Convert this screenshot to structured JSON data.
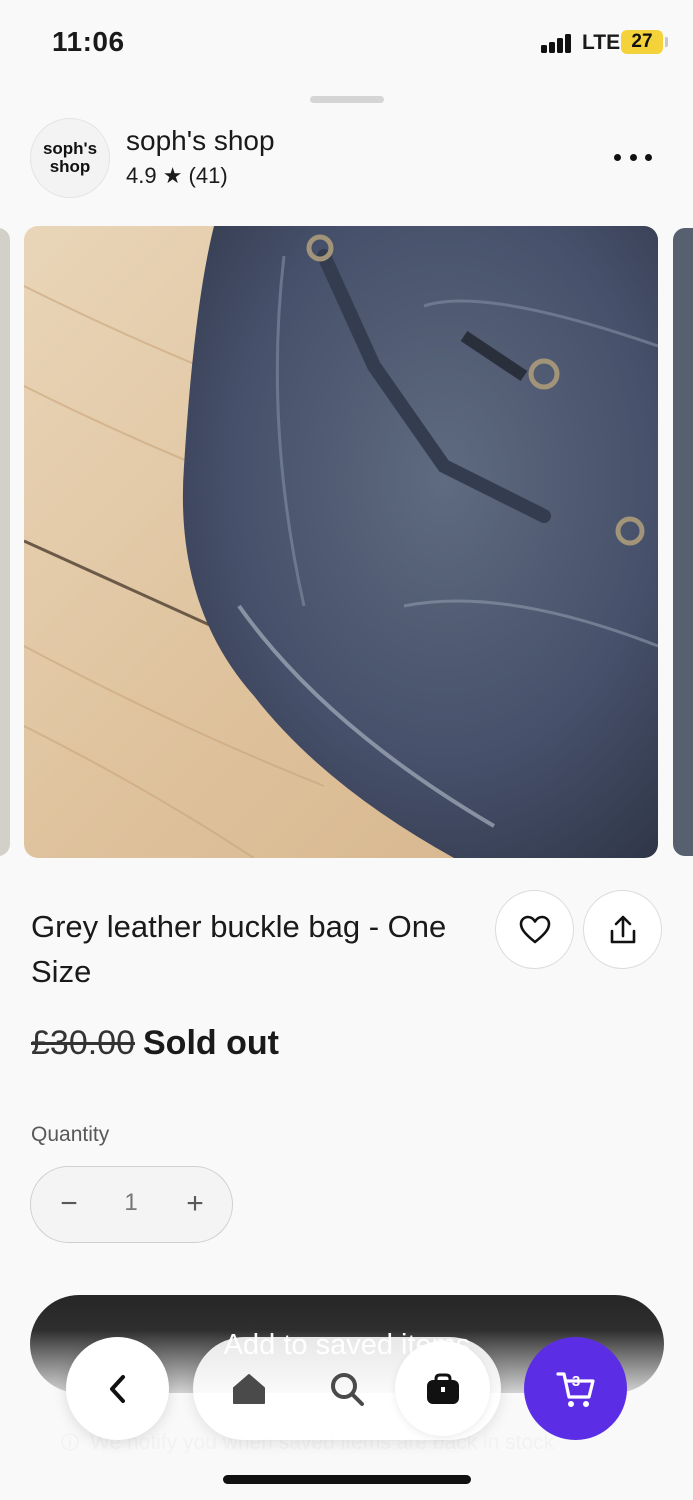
{
  "status_bar": {
    "time": "11:06",
    "network": "LTE",
    "battery": "27"
  },
  "shop": {
    "logo_text": "soph's shop",
    "name": "soph's shop",
    "rating": "4.9 ★ (41)"
  },
  "product": {
    "title": "Grey leather buckle bag - One Size",
    "price_original": "£30.00",
    "availability": "Sold out"
  },
  "quantity": {
    "label": "Quantity",
    "value": "1",
    "minus": "−",
    "plus": "+"
  },
  "saved_button": {
    "label": "Add to saved items"
  },
  "info_note": {
    "text": "We notify you when saved items are back in stock"
  },
  "bottom_nav": {
    "cart_count": "3"
  },
  "icons": {
    "more": "more-horizontal-icon",
    "favorite": "heart-icon",
    "share": "share-icon",
    "back": "chevron-left-icon",
    "home": "home-icon",
    "search": "search-icon",
    "shop": "bag-icon",
    "cart": "cart-icon",
    "info": "info-icon"
  },
  "colors": {
    "accent": "#5b2ee6",
    "button_dark": "#2b2b2b",
    "battery": "#f4d33a"
  }
}
